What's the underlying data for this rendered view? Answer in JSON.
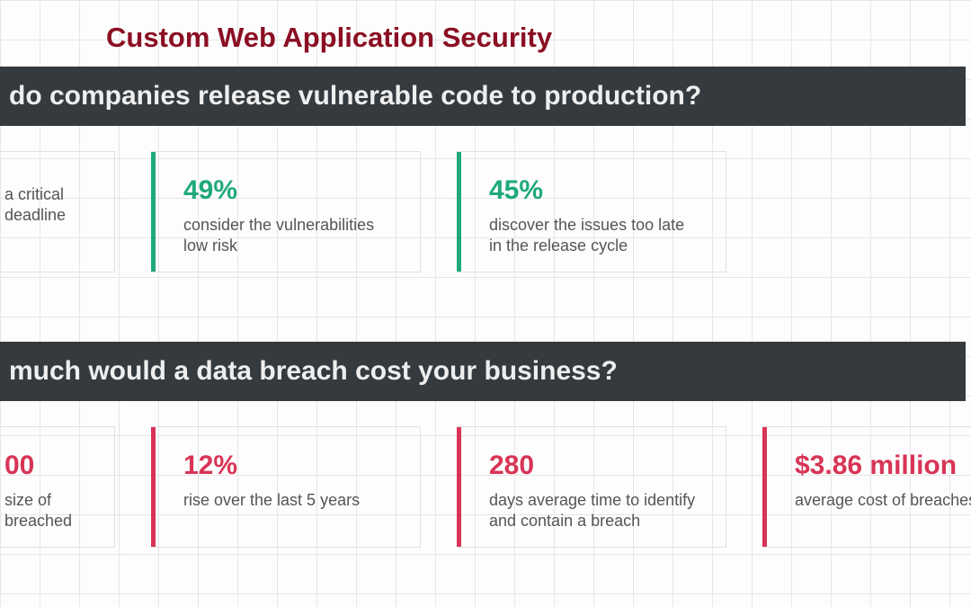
{
  "title": "Custom Web Application Security",
  "sections": [
    {
      "heading": "do companies release vulnerable code to production?",
      "accent": "#1fa97a",
      "cards": [
        {
          "stat": "",
          "desc": "a critical deadline"
        },
        {
          "stat": "49%",
          "desc": "consider the vulnerabilities low risk"
        },
        {
          "stat": "45%",
          "desc": "discover the issues too late in the release cycle"
        }
      ]
    },
    {
      "heading": "much would a data breach cost your business?",
      "accent": "#d83456",
      "cards": [
        {
          "stat": "00",
          "desc": "size of breached"
        },
        {
          "stat": "12%",
          "desc": "rise over the last 5 years"
        },
        {
          "stat": "280",
          "desc": "days average time to identify and contain a breach"
        },
        {
          "stat": "$3.86 million",
          "desc": "average cost of breaches"
        }
      ]
    }
  ]
}
